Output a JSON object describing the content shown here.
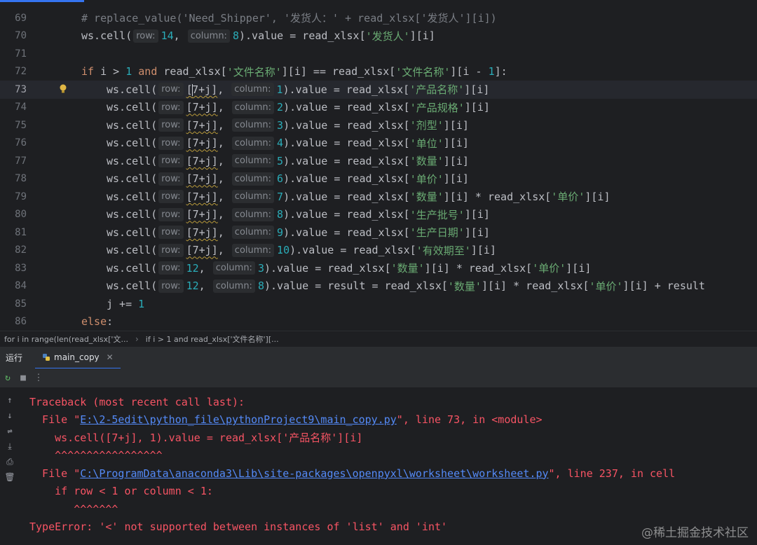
{
  "editor": {
    "hint_row": "row:",
    "hint_col": "column:",
    "lines": [
      {
        "num": "69",
        "comment": "# replace_value('Need_Shipper', '发货人：' + read_xlsx['发货人'][i])"
      },
      {
        "num": "70"
      },
      {
        "num": "71"
      },
      {
        "num": "72"
      },
      {
        "num": "73"
      },
      {
        "num": "74"
      },
      {
        "num": "75"
      },
      {
        "num": "76"
      },
      {
        "num": "77"
      },
      {
        "num": "78"
      },
      {
        "num": "79"
      },
      {
        "num": "80"
      },
      {
        "num": "81"
      },
      {
        "num": "82"
      },
      {
        "num": "83"
      },
      {
        "num": "84"
      },
      {
        "num": "85"
      },
      {
        "num": "86"
      }
    ]
  },
  "breadcrumb": {
    "items": [
      "for i in range(len(read_xlsx['文...",
      "if i > 1 and read_xlsx['文件名称'][..."
    ]
  },
  "run_panel": {
    "title": "运行",
    "tab_label": "main_copy"
  },
  "console": {
    "traceback_header": "Traceback (most recent call last):",
    "frame1_prefix": "  File \"",
    "frame1_path": "E:\\2-5edit\\python_file\\pythonProject9\\main_copy.py",
    "frame1_suffix": "\", line 73, in <module>",
    "frame1_code": "    ws.cell([7+j], 1).value = read_xlsx['产品名称'][i]",
    "frame1_carets": "    ^^^^^^^^^^^^^^^^^",
    "frame2_prefix": "  File \"",
    "frame2_path": "C:\\ProgramData\\anaconda3\\Lib\\site-packages\\openpyxl\\worksheet\\worksheet.py",
    "frame2_suffix": "\", line 237, in cell",
    "frame2_code": "    if row < 1 or column < 1:",
    "frame2_carets": "       ^^^^^^^",
    "error": "TypeError: '<' not supported between instances of 'list' and 'int'",
    "watermark": "@稀土掘金技术社区"
  },
  "colors": {
    "background": "#1e1f22",
    "keyword": "#cf8e6d",
    "number": "#2aacb8",
    "string": "#6aab73",
    "error": "#f75464",
    "link": "#548af7",
    "accent": "#3574f0"
  }
}
